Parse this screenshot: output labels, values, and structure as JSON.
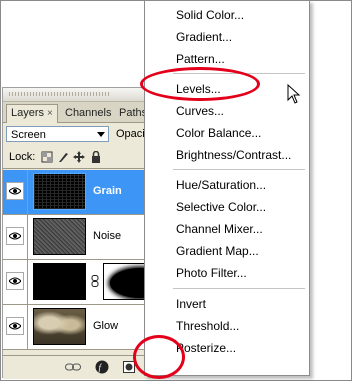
{
  "layers_panel": {
    "tabs": [
      "Layers",
      "Channels",
      "Paths"
    ],
    "blend_mode": "Screen",
    "opacity_label": "Opaci",
    "lock_label": "Lock:",
    "layers": [
      {
        "name": "Grain",
        "selected": true,
        "visible": true
      },
      {
        "name": "Noise",
        "selected": false,
        "visible": true
      },
      {
        "name": "",
        "selected": false,
        "visible": true
      },
      {
        "name": "Glow",
        "selected": false,
        "visible": true
      }
    ]
  },
  "adjustment_menu": {
    "items": [
      "Solid Color...",
      "Gradient...",
      "Pattern...",
      "Levels...",
      "Curves...",
      "Color Balance...",
      "Brightness/Contrast...",
      "Hue/Saturation...",
      "Selective Color...",
      "Channel Mixer...",
      "Gradient Map...",
      "Photo Filter...",
      "Invert",
      "Threshold...",
      "Posterize..."
    ],
    "highlighted_item": "Levels..."
  },
  "colors": {
    "annotation_red": "#e3001b",
    "selection_blue": "#3d96f5",
    "panel_bg": "#ece9d8"
  }
}
